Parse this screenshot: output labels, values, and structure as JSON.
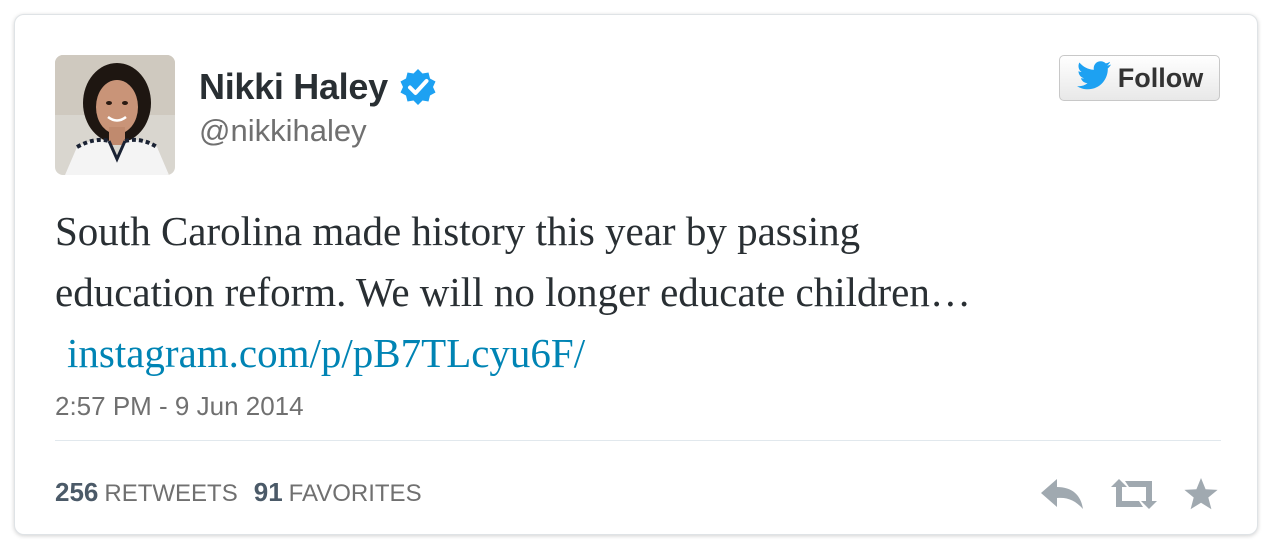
{
  "author": {
    "display_name": "Nikki Haley",
    "handle": "@nikkihaley",
    "verified": true
  },
  "follow_button": {
    "label": "Follow",
    "icon": "twitter-bird-icon"
  },
  "tweet": {
    "text_line1": "South Carolina made history this year by passing",
    "text_line2": "education reform. We will no longer educate children…",
    "link": "instagram.com/p/pB7TLcyu6F/",
    "timestamp": "2:57 PM - 9 Jun 2014"
  },
  "stats": {
    "retweets_count": "256",
    "retweets_label": "RETWEETS",
    "favorites_count": "91",
    "favorites_label": "FAVORITES"
  },
  "actions": [
    {
      "name": "reply-icon"
    },
    {
      "name": "retweet-icon"
    },
    {
      "name": "favorite-icon"
    }
  ],
  "colors": {
    "link": "#0084b4",
    "verified_badge": "#1da1f2",
    "twitter_bird": "#1da1f2",
    "text": "#292f33",
    "muted": "#707070",
    "action_icons": "#a0a9b0"
  }
}
